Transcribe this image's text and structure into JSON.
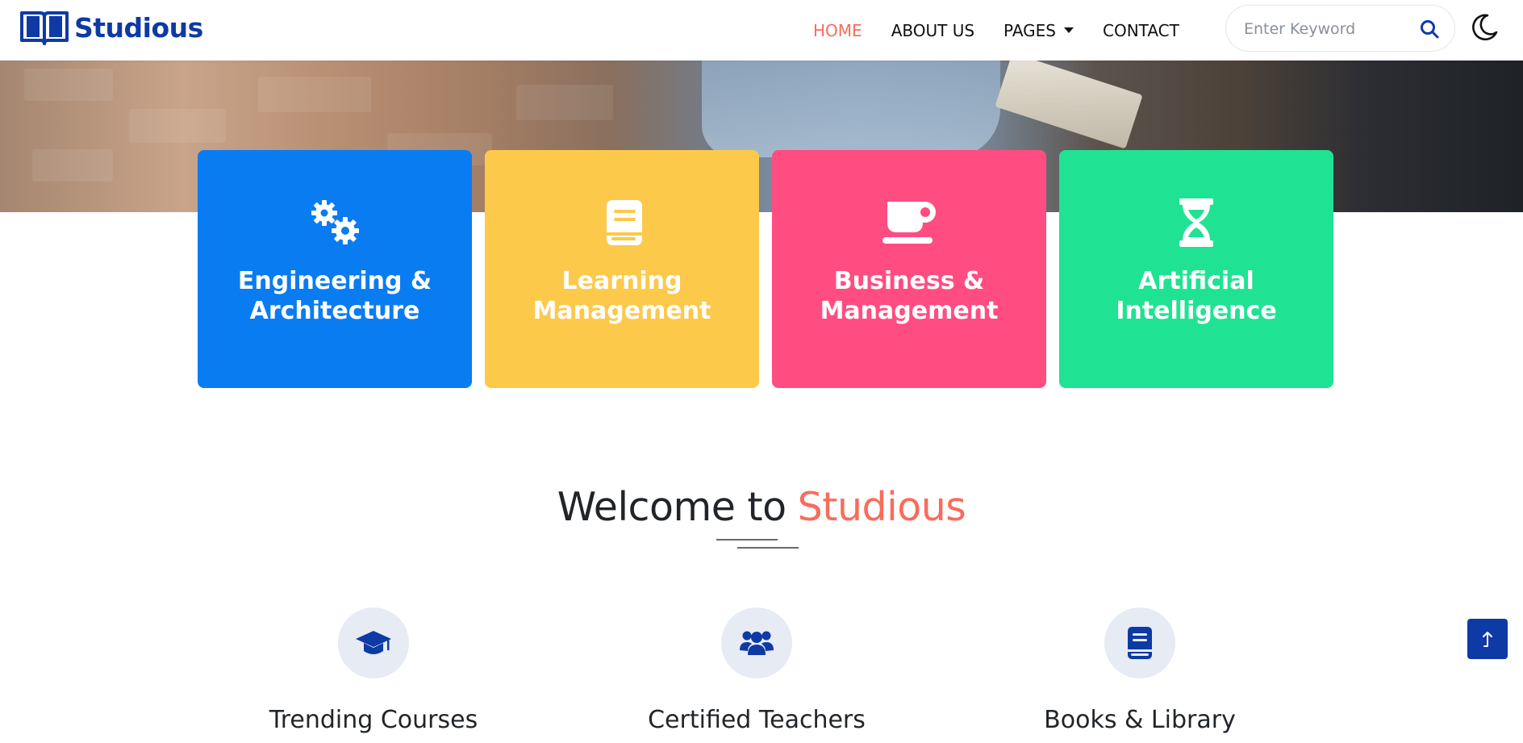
{
  "brand": {
    "name": "Studious",
    "icon": "open-book-icon",
    "color": "#0e3aa5"
  },
  "nav": {
    "items": [
      {
        "label": "HOME",
        "active": true
      },
      {
        "label": "ABOUT US",
        "active": false
      },
      {
        "label": "PAGES",
        "active": false,
        "dropdown": true
      },
      {
        "label": "CONTACT",
        "active": false
      }
    ],
    "active_color": "#f96c5b"
  },
  "search": {
    "placeholder": "Enter Keyword",
    "value": "",
    "icon": "search-icon"
  },
  "theme_toggle": {
    "icon": "moon-icon"
  },
  "categories": [
    {
      "title": "Engineering & Architecture",
      "icon": "gears-icon",
      "color": "#0a7cf2"
    },
    {
      "title": "Learning Management",
      "icon": "book-icon",
      "color": "#fdc94b"
    },
    {
      "title": "Business & Management",
      "icon": "coffee-cup-icon",
      "color": "#ff4d81"
    },
    {
      "title": "Artificial Intelligence",
      "icon": "hourglass-icon",
      "color": "#1fe392"
    }
  ],
  "welcome": {
    "prefix": "Welcome to",
    "highlight": "Studious"
  },
  "features": [
    {
      "title": "Trending Courses",
      "icon": "graduation-cap-icon"
    },
    {
      "title": "Certified Teachers",
      "icon": "users-icon"
    },
    {
      "title": "Books & Library",
      "icon": "book-icon"
    }
  ],
  "back_to_top": {
    "icon": "arrow-up-icon"
  }
}
